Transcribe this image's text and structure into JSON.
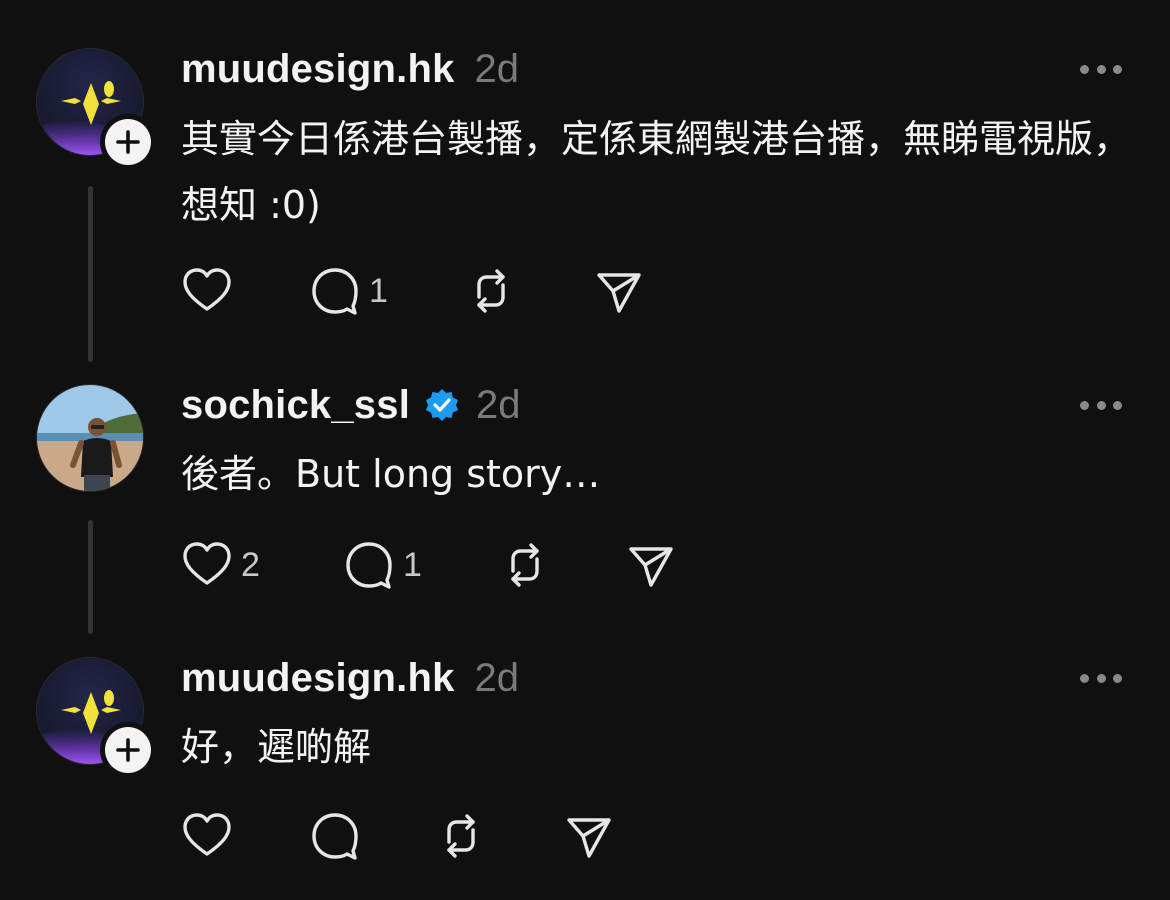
{
  "posts": [
    {
      "username": "muudesign.hk",
      "time": "2d",
      "text": "其實今日係港台製播，定係東網製港台播，無睇電視版，想知 :0)",
      "verified": false,
      "likes": "",
      "replies": "1",
      "reposts": "",
      "avatar": "muudesign-logo",
      "follow_badge": true
    },
    {
      "username": "sochick_ssl",
      "time": "2d",
      "text": "後者。But long story…",
      "verified": true,
      "likes": "2",
      "replies": "1",
      "reposts": "",
      "avatar": "beach-photo",
      "follow_badge": false
    },
    {
      "username": "muudesign.hk",
      "time": "2d",
      "text": "好，遲啲解",
      "verified": false,
      "likes": "",
      "replies": "",
      "reposts": "",
      "avatar": "muudesign-logo",
      "follow_badge": true
    }
  ],
  "icons": {
    "like": "heart-icon",
    "reply": "comment-icon",
    "repost": "repost-icon",
    "share": "send-icon",
    "more": "more-dots-icon",
    "verified": "verified-badge-icon",
    "follow": "plus-icon"
  },
  "colors": {
    "background": "#101010",
    "text": "#f3f3f3",
    "muted": "#7a7a7a",
    "verified": "#1d9bf0",
    "thread_line": "#333333"
  }
}
